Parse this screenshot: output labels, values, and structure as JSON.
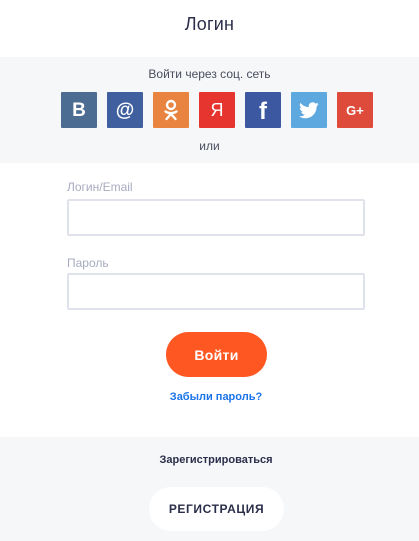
{
  "header": {
    "title": "Логин"
  },
  "social": {
    "caption": "Войти через соц. сеть",
    "or_text": "или",
    "buttons": [
      {
        "id": "vk",
        "label": "В",
        "color": "#4c6c91",
        "icon": "vk-icon"
      },
      {
        "id": "mail",
        "label": "@",
        "color": "#3f5f9e",
        "icon": "mailru-icon"
      },
      {
        "id": "ok",
        "label": "",
        "color": "#e8843f",
        "icon": "odnoklassniki-icon"
      },
      {
        "id": "yandex",
        "label": "Я",
        "color": "#e6342f",
        "icon": "yandex-icon"
      },
      {
        "id": "facebook",
        "label": "f",
        "color": "#3b58a0",
        "icon": "facebook-icon"
      },
      {
        "id": "twitter",
        "label": "",
        "color": "#5ea8e0",
        "icon": "twitter-icon"
      },
      {
        "id": "google",
        "label": "G+",
        "color": "#df4b3a",
        "icon": "google-plus-icon"
      }
    ]
  },
  "form": {
    "login_label": "Логин/Email",
    "login_value": "",
    "password_label": "Пароль",
    "password_value": "",
    "submit_label": "Войти",
    "forgot_label": "Забыли пароль?"
  },
  "register": {
    "caption": "Зарегистрироваться",
    "button_label": "РЕГИСТРАЦИЯ"
  }
}
